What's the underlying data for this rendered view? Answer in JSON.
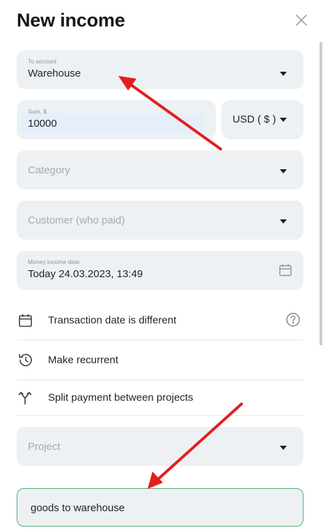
{
  "header": {
    "title": "New income",
    "close_icon": "close-icon"
  },
  "to_account": {
    "label": "To account",
    "value": "Warehouse"
  },
  "sum": {
    "label": "Sum, $",
    "value": "10000"
  },
  "currency": {
    "value": "USD ( $ )"
  },
  "category": {
    "placeholder": "Category"
  },
  "customer": {
    "placeholder": "Customer (who paid)"
  },
  "income_date": {
    "label": "Money income date",
    "value": "Today 24.03.2023, 13:49"
  },
  "options": {
    "transaction_date": {
      "label": "Transaction date is different",
      "icon": "calendar-icon",
      "help_icon": "help-icon"
    },
    "recurrent": {
      "label": "Make recurrent",
      "icon": "history-icon"
    },
    "split": {
      "label": "Split payment between projects",
      "icon": "split-icon"
    }
  },
  "project": {
    "placeholder": "Project"
  },
  "comment": {
    "value": "goods to warehouse"
  },
  "colors": {
    "field_bg": "#edf1f3",
    "accent_green": "#4fae74",
    "arrow_red": "#e41e1e",
    "sum_highlight": "#e6eefb"
  }
}
